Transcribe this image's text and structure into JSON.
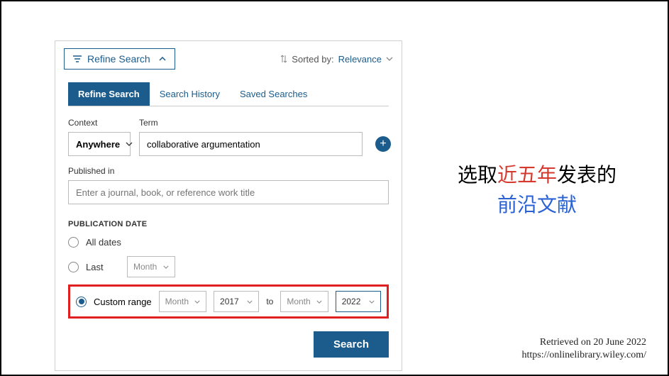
{
  "refine_button": "Refine Search",
  "sorted_by_label": "Sorted by:",
  "sorted_by_value": "Relevance",
  "tabs": {
    "refine": "Refine Search",
    "history": "Search History",
    "saved": "Saved Searches"
  },
  "context": {
    "label": "Context",
    "value": "Anywhere"
  },
  "term": {
    "label": "Term",
    "value": "collaborative argumentation"
  },
  "published_in": {
    "label": "Published in",
    "placeholder": "Enter a journal, book, or reference work title"
  },
  "pub_date": {
    "section_title": "PUBLICATION DATE",
    "all_dates": "All dates",
    "last": "Last",
    "last_unit": "Month",
    "custom_range": "Custom range",
    "from_month": "Month",
    "from_year": "2017",
    "to_label": "to",
    "to_month": "Month",
    "to_year": "2022"
  },
  "search_button": "Search",
  "annotation": {
    "line1_a": "选取",
    "line1_b": "近五年",
    "line1_c": "发表的",
    "line2": "前沿文献"
  },
  "footer": {
    "retrieved": "Retrieved on 20 June 2022",
    "url": "https://onlinelibrary.wiley.com/"
  }
}
